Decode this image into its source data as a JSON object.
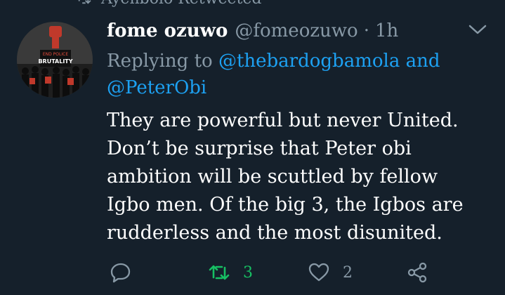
{
  "retweet_context": {
    "text": "Ayenbolo Retweeted"
  },
  "tweet": {
    "author": {
      "display_name": "fome ozuwo",
      "handle": "@fomeozuwo",
      "avatar": {
        "text_top": "END POLICE",
        "text_main": "BRUTALITY"
      }
    },
    "separator": "·",
    "time": "1h",
    "replying_to": {
      "prefix": "Replying to",
      "mention_1": "@thebardogbamola",
      "conjunction": "and",
      "mention_2": "@PeterObi"
    },
    "text_lines": [
      "They are powerful but never United.",
      "Don’t be surprise that Peter obi",
      "ambition will be scuttled by  fellow",
      "Igbo men. Of the big 3, the Igbos are",
      "rudderless and the most disunited."
    ],
    "actions": {
      "reply": {
        "icon": "reply-icon",
        "count": ""
      },
      "retweet": {
        "icon": "retweet-icon",
        "count": "3",
        "active": true
      },
      "like": {
        "icon": "heart-icon",
        "count": "2"
      },
      "share": {
        "icon": "share-icon"
      }
    }
  },
  "colors": {
    "background": "#15202b",
    "text": "#ffffff",
    "muted": "#8899a6",
    "link": "#1da1f2",
    "retweet_active": "#17bf63"
  }
}
